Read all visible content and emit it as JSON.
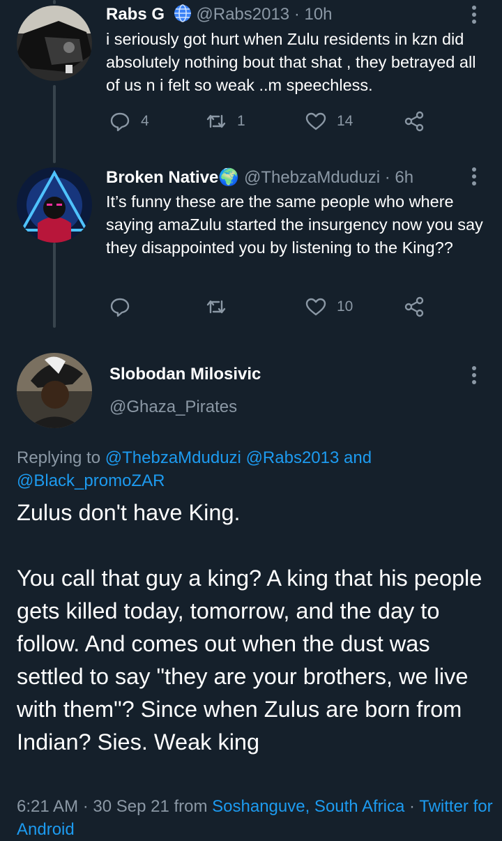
{
  "tweets": [
    {
      "name": "Rabs G",
      "handle": "@Rabs2013",
      "time": "· 10h",
      "text": "i seriously got hurt when Zulu residents in kzn did absolutely nothing bout that shat , they betrayed all of us n i felt so weak ..m speechless.",
      "replies": "4",
      "retweets": "1",
      "likes": "14"
    },
    {
      "name": "Broken Native",
      "name_emoji": "🌍",
      "handle": "@ThebzaMduduzi",
      "time": "· 6h",
      "text": "It’s funny these are the same people who where saying amaZulu started the insurgency now you say they disappointed you by listening to the King??",
      "likes": "10"
    }
  ],
  "main": {
    "name": "Slobodan Milosivic",
    "handle": "@Ghaza_Pirates",
    "replying_prefix": "Replying to",
    "mention_1": "@ThebzaMduduzi",
    "mention_2": "@Rabs2013",
    "and": "and",
    "mention_3": "@Black_promoZAR",
    "text": "Zulus don't have King.\n\nYou call that guy a king? A king that his people gets killed today, tomorrow, and the day to follow. And comes out when the dust was settled to say \"they are your brothers, we live with them\"? Since when Zulus are born from Indian? Sies. Weak king",
    "timestamp": "6:21 AM · 30 Sep 21 from",
    "location": "Soshanguve, South Africa",
    "sep": "·",
    "client": "Twitter for Android"
  },
  "colors": {
    "background": "#15202b",
    "accent": "#1d9bf0",
    "muted": "#8b98a5"
  },
  "icons": [
    "globe-icon",
    "more-icon",
    "reply-icon",
    "retweet-icon",
    "like-icon",
    "share-icon"
  ]
}
